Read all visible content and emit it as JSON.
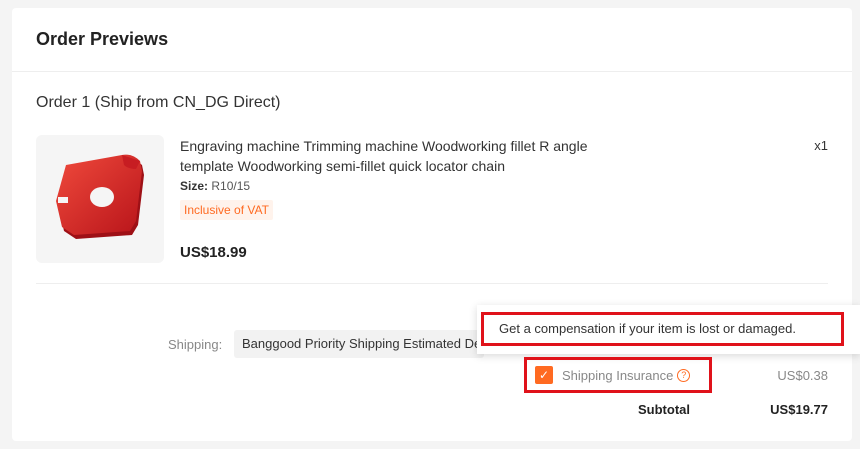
{
  "header": {
    "title": "Order Previews"
  },
  "order": {
    "title": "Order 1 (Ship from CN_DG Direct)",
    "product": {
      "image_icon": "red-corner-template-product-image",
      "name": "Engraving machine Trimming machine Woodworking fillet R angle template Woodworking semi-fillet quick locator chain",
      "size_label": "Size:",
      "size_value": "R10/15",
      "vat_badge": "Inclusive of VAT",
      "price": "US$18.99",
      "quantity": "x1"
    }
  },
  "shipping": {
    "label": "Shipping:",
    "selected_method": "Banggood Priority Shipping Estimated Delivery"
  },
  "tooltip": {
    "text": "Get a compensation if your item is lost or damaged."
  },
  "insurance": {
    "checked": true,
    "label": "Shipping Insurance",
    "help_icon": "question-circle-icon",
    "price": "US$0.38"
  },
  "subtotal": {
    "label": "Subtotal",
    "value": "US$19.77"
  },
  "colors": {
    "accent": "#ff6a21",
    "highlight": "#e0121a"
  }
}
